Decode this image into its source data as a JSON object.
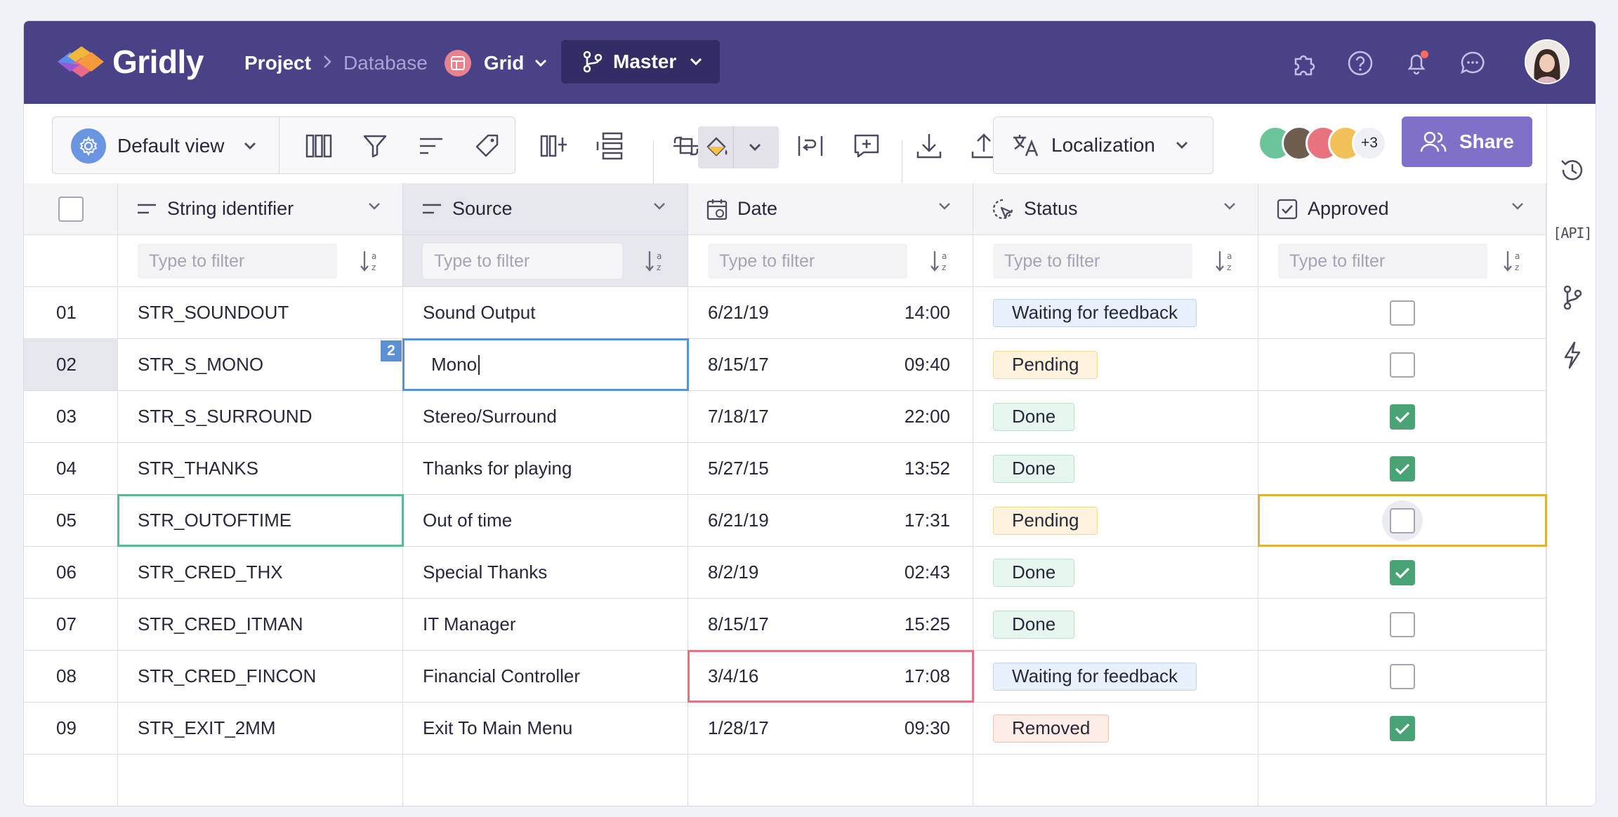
{
  "header": {
    "logo_text": "Gridly",
    "breadcrumb": {
      "project": "Project",
      "database": "Database",
      "grid": "Grid"
    },
    "branch": "Master",
    "icons": [
      "puzzle-icon",
      "help-icon",
      "bell-icon",
      "chat-icon"
    ],
    "notification_dot_color": "#ff6a5c"
  },
  "toolbar": {
    "view": "Default view",
    "localization": "Localization",
    "collaborators_more": "+3",
    "share": "Share"
  },
  "rail": {
    "api_label": "[API]"
  },
  "grid": {
    "filter_placeholder": "Type to filter",
    "columns": [
      {
        "key": "string_identifier",
        "label": "String identifier",
        "icon": "text-icon"
      },
      {
        "key": "source",
        "label": "Source",
        "icon": "text-icon"
      },
      {
        "key": "date",
        "label": "Date",
        "icon": "calendar-icon"
      },
      {
        "key": "status",
        "label": "Status",
        "icon": "status-icon"
      },
      {
        "key": "approved",
        "label": "Approved",
        "icon": "checkbox-icon"
      }
    ],
    "rows": [
      {
        "num": "01",
        "id": "STR_SOUNDOUT",
        "source": "Sound Output",
        "date": "6/21/19",
        "time": "14:00",
        "status": "Waiting for feedback",
        "status_type": "waiting",
        "approved": false
      },
      {
        "num": "02",
        "id": "STR_S_MONO",
        "source": "Mono",
        "date": "8/15/17",
        "time": "09:40",
        "status": "Pending",
        "status_type": "pending",
        "approved": false
      },
      {
        "num": "03",
        "id": "STR_S_SURROUND",
        "source": "Stereo/Surround",
        "date": "7/18/17",
        "time": "22:00",
        "status": "Done",
        "status_type": "done",
        "approved": true
      },
      {
        "num": "04",
        "id": "STR_THANKS",
        "source": "Thanks for playing",
        "date": "5/27/15",
        "time": "13:52",
        "status": "Done",
        "status_type": "done",
        "approved": true
      },
      {
        "num": "05",
        "id": "STR_OUTOFTIME",
        "source": "Out of time",
        "date": "6/21/19",
        "time": "17:31",
        "status": "Pending",
        "status_type": "pending",
        "approved": false
      },
      {
        "num": "06",
        "id": "STR_CRED_THX",
        "source": "Special Thanks",
        "date": "8/2/19",
        "time": "02:43",
        "status": "Done",
        "status_type": "done",
        "approved": true
      },
      {
        "num": "07",
        "id": "STR_CRED_ITMAN",
        "source": "IT Manager",
        "date": "8/15/17",
        "time": "15:25",
        "status": "Done",
        "status_type": "done",
        "approved": false
      },
      {
        "num": "08",
        "id": "STR_CRED_FINCON",
        "source": "Financial Controller",
        "date": "3/4/16",
        "time": "17:08",
        "status": "Waiting for feedback",
        "status_type": "waiting",
        "approved": false
      },
      {
        "num": "09",
        "id": "STR_EXIT_2MM",
        "source": "Exit To Main Menu",
        "date": "1/28/17",
        "time": "09:30",
        "status": "Removed",
        "status_type": "removed",
        "approved": true
      }
    ],
    "collaborator_tag": "2"
  },
  "colors": {
    "header_bg": "#4a4287",
    "branch_bg": "#332d66",
    "share_bg": "#8070c8",
    "selection_blue": "#5b8fd6",
    "selection_green": "#5cb893",
    "selection_orange": "#e5ad3e",
    "selection_red": "#e0767e",
    "approved_green": "#4aa374"
  }
}
